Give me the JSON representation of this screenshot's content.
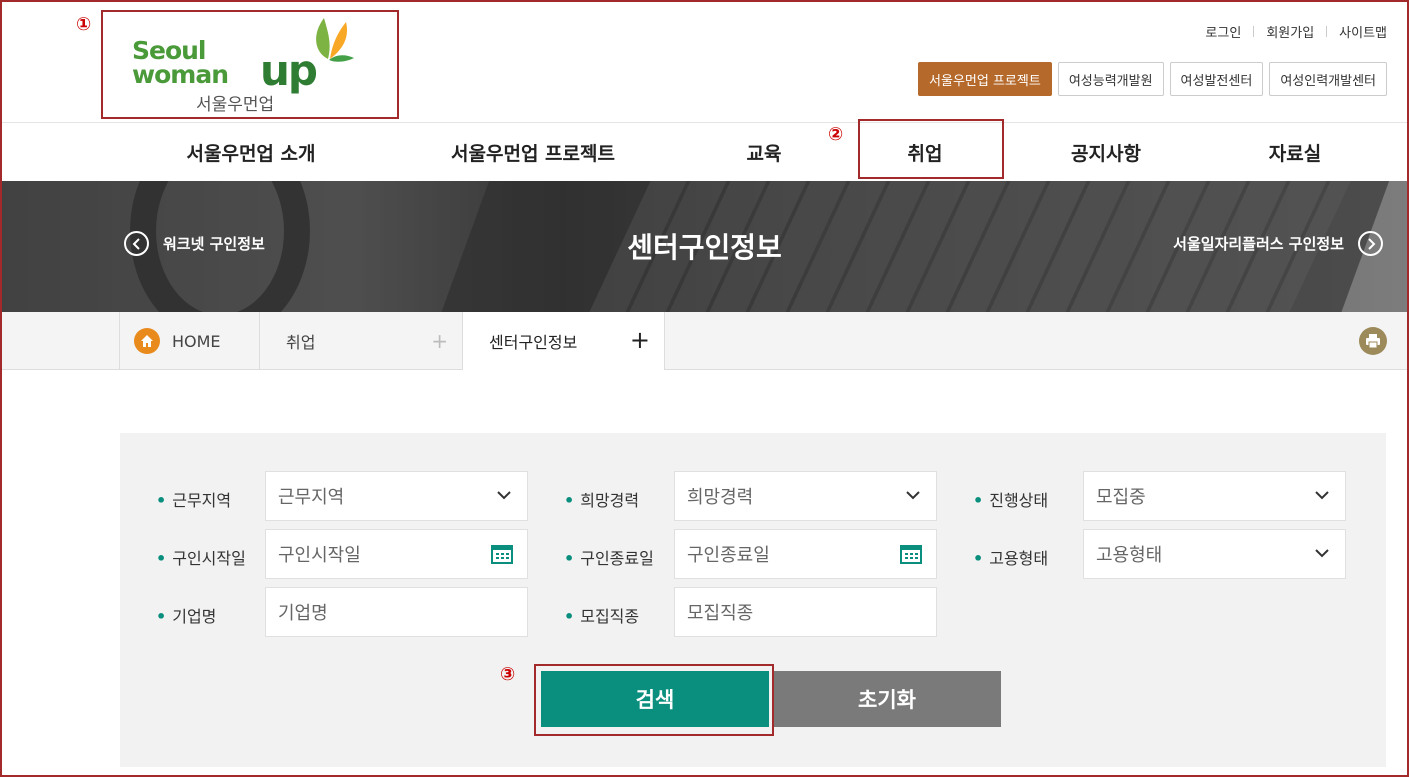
{
  "logo": {
    "line1": "Seoul",
    "line2": "woman",
    "line3": "up",
    "korean": "서울우먼업"
  },
  "top_links": [
    "로그인",
    "회원가입",
    "사이트맵"
  ],
  "site_buttons": [
    "서울우먼업 프로젝트",
    "여성능력개발원",
    "여성발전센터",
    "여성인력개발센터"
  ],
  "gnb": [
    "서울우먼업 소개",
    "서울우먼업 프로젝트",
    "교육",
    "취업",
    "공지사항",
    "자료실"
  ],
  "banner": {
    "title": "센터구인정보",
    "prev": "워크넷 구인정보",
    "next": "서울일자리플러스 구인정보"
  },
  "breadcrumb": {
    "home": "HOME",
    "level1": "취업",
    "level2": "센터구인정보"
  },
  "form": {
    "work_region": {
      "label": "근무지역",
      "value": "근무지역"
    },
    "desired_career": {
      "label": "희망경력",
      "value": "희망경력"
    },
    "progress_status": {
      "label": "진행상태",
      "value": "모집중"
    },
    "start_date": {
      "label": "구인시작일",
      "value": "구인시작일"
    },
    "end_date": {
      "label": "구인종료일",
      "value": "구인종료일"
    },
    "employment_type": {
      "label": "고용형태",
      "value": "고용형태"
    },
    "company": {
      "label": "기업명",
      "value": "기업명"
    },
    "job_type": {
      "label": "모집직종",
      "value": "모집직종"
    }
  },
  "buttons": {
    "search": "검색",
    "reset": "초기화"
  },
  "annotations": [
    "①",
    "②",
    "③"
  ],
  "colors": {
    "accent": "#0a8f7e",
    "brand_orange": "#b5692a",
    "annotation": "#a32a2a"
  }
}
